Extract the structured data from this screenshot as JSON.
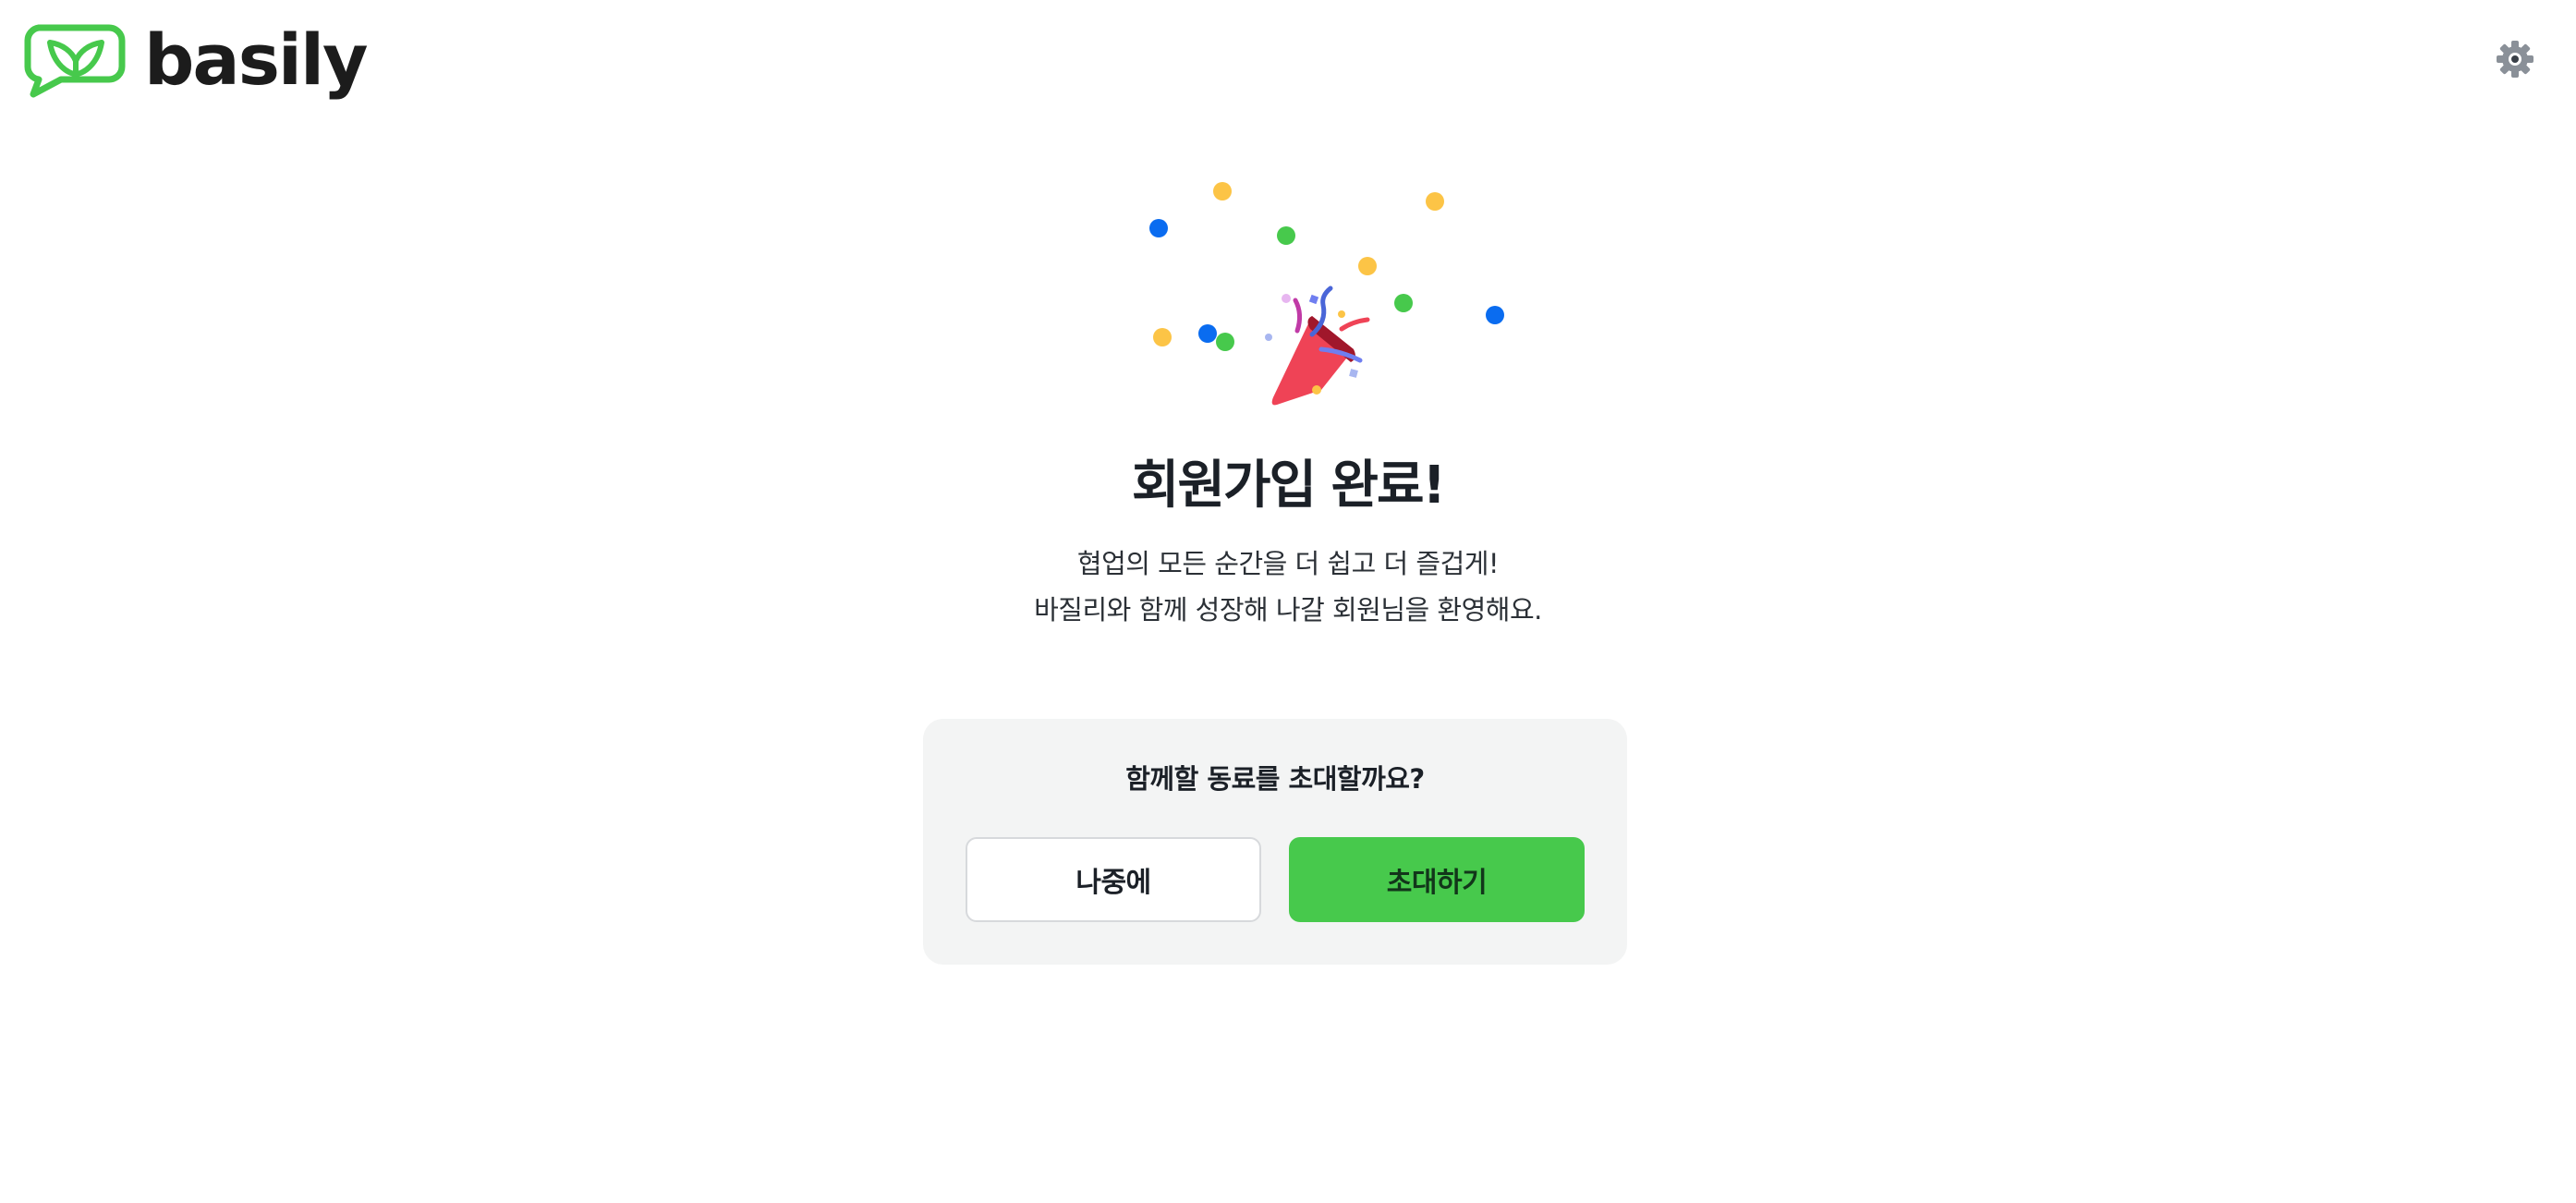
{
  "brand": {
    "name": "basily",
    "accent_color": "#47c94c",
    "logo_icon": "leaf-speech-bubble-icon"
  },
  "header": {
    "settings_icon": "gear-icon"
  },
  "hero": {
    "illustration_icon": "party-popper-icon",
    "title": "회원가입 완료!",
    "subtitle_line1": "협업의 모든 순간을 더 쉽고 더 즐겁게!",
    "subtitle_line2": "바질리와 함께 성장해 나갈 회원님을 환영해요."
  },
  "invite_card": {
    "question": "함께할 동료를 초대할까요?",
    "later_label": "나중에",
    "invite_label": "초대하기"
  }
}
